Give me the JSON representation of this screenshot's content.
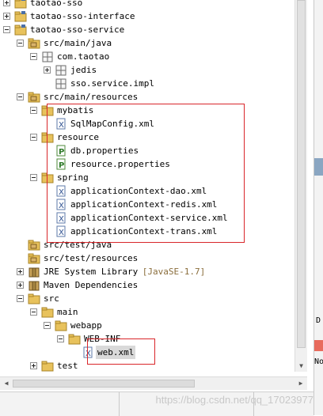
{
  "tree": [
    {
      "label": "taotao-sso",
      "icon": "project-folder-icon",
      "depth": 0,
      "twisty": "plus"
    },
    {
      "label": "taotao-sso-interface",
      "icon": "project-folder-icon",
      "depth": 0,
      "twisty": "plus"
    },
    {
      "label": "taotao-sso-service",
      "icon": "project-folder-icon",
      "depth": 0,
      "twisty": "minus"
    },
    {
      "label": "src/main/java",
      "icon": "source-folder-icon",
      "depth": 1,
      "twisty": "minus"
    },
    {
      "label": "com.taotao",
      "icon": "package-icon",
      "depth": 2,
      "twisty": "minus"
    },
    {
      "label": "jedis",
      "icon": "package-icon",
      "depth": 3,
      "twisty": "plus"
    },
    {
      "label": "sso.service.impl",
      "icon": "package-icon",
      "depth": 3,
      "twisty": ""
    },
    {
      "label": "src/main/resources",
      "icon": "source-folder-icon",
      "depth": 1,
      "twisty": "minus"
    },
    {
      "label": "mybatis",
      "icon": "folder-icon",
      "depth": 2,
      "twisty": "minus"
    },
    {
      "label": "SqlMapConfig.xml",
      "icon": "xml-file-icon",
      "depth": 3,
      "twisty": ""
    },
    {
      "label": "resource",
      "icon": "folder-icon",
      "depth": 2,
      "twisty": "minus"
    },
    {
      "label": "db.properties",
      "icon": "properties-file-icon",
      "depth": 3,
      "twisty": ""
    },
    {
      "label": "resource.properties",
      "icon": "properties-file-icon",
      "depth": 3,
      "twisty": ""
    },
    {
      "label": "spring",
      "icon": "folder-icon",
      "depth": 2,
      "twisty": "minus"
    },
    {
      "label": "applicationContext-dao.xml",
      "icon": "xml-file-icon",
      "depth": 3,
      "twisty": ""
    },
    {
      "label": "applicationContext-redis.xml",
      "icon": "xml-file-icon",
      "depth": 3,
      "twisty": ""
    },
    {
      "label": "applicationContext-service.xml",
      "icon": "xml-file-icon",
      "depth": 3,
      "twisty": ""
    },
    {
      "label": "applicationContext-trans.xml",
      "icon": "xml-file-icon",
      "depth": 3,
      "twisty": ""
    },
    {
      "label": "src/test/java",
      "icon": "source-folder-icon",
      "depth": 1,
      "twisty": ""
    },
    {
      "label": "src/test/resources",
      "icon": "source-folder-icon",
      "depth": 1,
      "twisty": ""
    },
    {
      "label": "JRE System Library",
      "suffix": "[JavaSE-1.7]",
      "icon": "library-icon",
      "depth": 1,
      "twisty": "plus"
    },
    {
      "label": "Maven Dependencies",
      "icon": "library-icon",
      "depth": 1,
      "twisty": "plus"
    },
    {
      "label": "src",
      "icon": "folder-icon",
      "depth": 1,
      "twisty": "minus"
    },
    {
      "label": "main",
      "icon": "folder-icon",
      "depth": 2,
      "twisty": "minus"
    },
    {
      "label": "webapp",
      "icon": "folder-icon",
      "depth": 3,
      "twisty": "minus"
    },
    {
      "label": "WEB-INF",
      "icon": "folder-icon",
      "depth": 4,
      "twisty": "minus"
    },
    {
      "label": "web.xml",
      "icon": "xml-file-icon",
      "depth": 5,
      "twisty": "",
      "selected": true
    },
    {
      "label": "test",
      "icon": "folder-icon",
      "depth": 2,
      "twisty": "plus"
    }
  ],
  "watermark": "https://blog.csdn.net/qq_17023977",
  "side_panel": {
    "letter": "D",
    "label": "No"
  },
  "colors": {
    "highlight_box": "#d9262a",
    "selection": "#d9d9d9",
    "folder": "#e8c25c"
  }
}
